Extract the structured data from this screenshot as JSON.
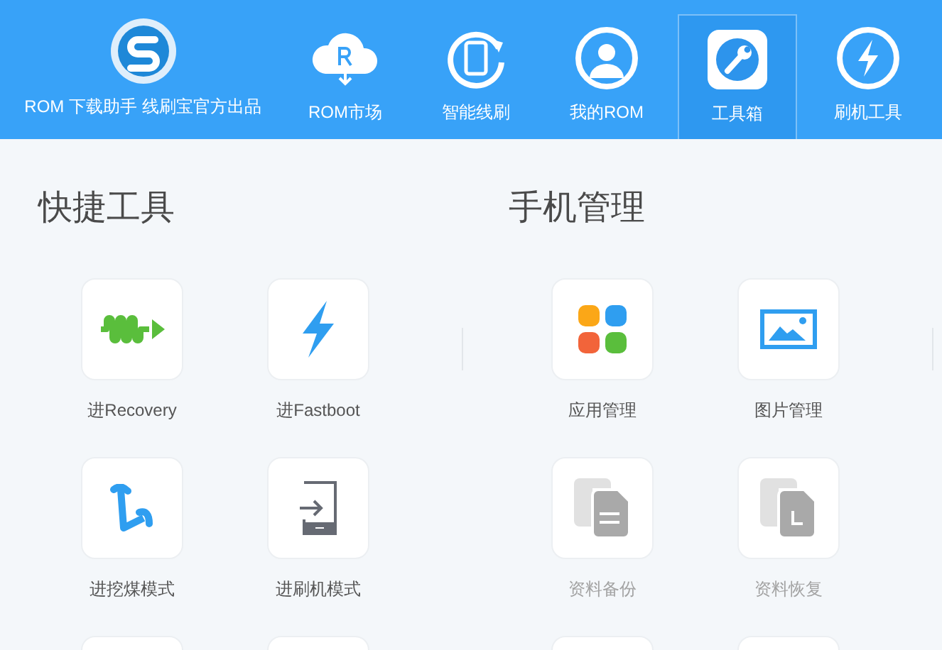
{
  "header": {
    "logo_caption": "ROM 下载助手 线刷宝官方出品",
    "nav": [
      {
        "label": "ROM市场",
        "kind": "cloud",
        "selected": false
      },
      {
        "label": "智能线刷",
        "kind": "phone",
        "selected": false
      },
      {
        "label": "我的ROM",
        "kind": "user",
        "selected": false
      },
      {
        "label": "工具箱",
        "kind": "wrench",
        "selected": true
      },
      {
        "label": "刷机工具",
        "kind": "bolt",
        "selected": false
      }
    ]
  },
  "sections": [
    {
      "title": "快捷工具",
      "tools": [
        {
          "label": "进Recovery",
          "kind": "wave",
          "disabled": false
        },
        {
          "label": "进Fastboot",
          "kind": "lightning",
          "disabled": false
        },
        {
          "label": "进挖煤模式",
          "kind": "pick",
          "disabled": false
        },
        {
          "label": "进刷机模式",
          "kind": "enter",
          "disabled": false
        },
        {
          "kind": "cutoff"
        },
        {
          "kind": "cutoff"
        }
      ]
    },
    {
      "title": "手机管理",
      "tools": [
        {
          "label": "应用管理",
          "kind": "apps",
          "disabled": false
        },
        {
          "label": "图片管理",
          "kind": "picture",
          "disabled": false
        },
        {
          "label": "资料备份",
          "kind": "backup",
          "disabled": true
        },
        {
          "label": "资料恢复",
          "kind": "restore",
          "disabled": true
        },
        {
          "kind": "cutoff"
        },
        {
          "kind": "cutoff"
        }
      ]
    }
  ]
}
